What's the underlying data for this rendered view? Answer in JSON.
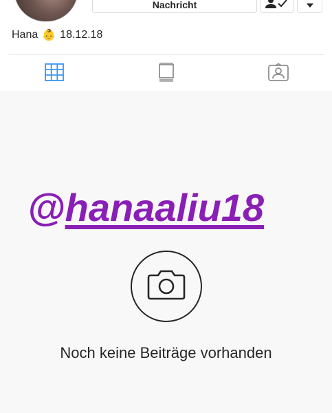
{
  "profile": {
    "message_button": "Nachricht",
    "bio_name": "Hana",
    "bio_emoji": "👶",
    "bio_date": "18.12.18"
  },
  "tabs": [
    {
      "name": "grid",
      "icon": "grid-icon",
      "active": true,
      "color": "#3897f0"
    },
    {
      "name": "feed",
      "icon": "feed-icon",
      "active": false
    },
    {
      "name": "tagged",
      "icon": "tagged-icon",
      "active": false
    }
  ],
  "overlay": {
    "at": "@",
    "handle": "hanaaliu18",
    "color": "#8a1fb5"
  },
  "empty_state": {
    "icon": "camera-icon",
    "message": "Noch keine Beiträge vorhanden"
  }
}
